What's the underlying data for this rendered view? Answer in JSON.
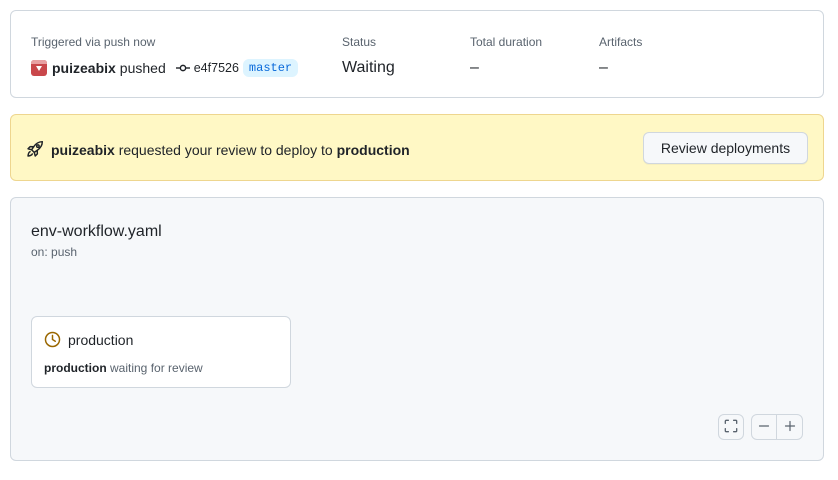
{
  "summary": {
    "trigger_label": "Triggered via push now",
    "actor": "puizeabix",
    "action": "pushed",
    "commit_sha": "e4f7526",
    "branch": "master",
    "status_label": "Status",
    "status_value": "Waiting",
    "duration_label": "Total duration",
    "duration_value": "–",
    "artifacts_label": "Artifacts",
    "artifacts_value": "–"
  },
  "review_banner": {
    "actor": "puizeabix",
    "message": "requested your review to deploy to",
    "environment": "production",
    "button_label": "Review deployments",
    "icon": "rocket-icon"
  },
  "workflow": {
    "file_name": "env-workflow.yaml",
    "trigger": "on: push",
    "job": {
      "name": "production",
      "environment": "production",
      "status_text": "waiting for review",
      "icon": "clock-icon",
      "icon_color": "#9a6700"
    },
    "controls": {
      "fullscreen_icon": "fullscreen-icon",
      "zoom_out_icon": "minus-icon",
      "zoom_in_icon": "plus-icon"
    }
  },
  "colors": {
    "banner_bg": "#fff8c5",
    "branch_badge_text": "#0969da",
    "branch_badge_bg": "#ddf4ff"
  }
}
